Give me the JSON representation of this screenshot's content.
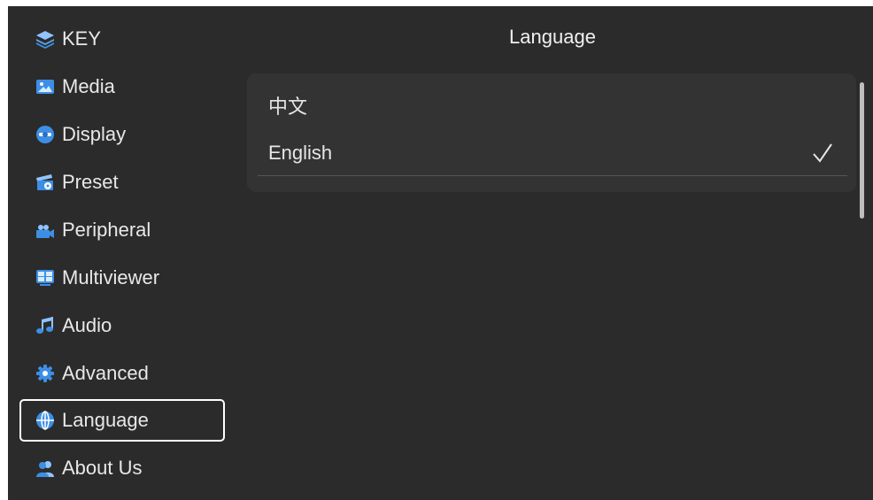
{
  "page": {
    "title": "Language"
  },
  "sidebar": {
    "items": [
      {
        "label": "KEY",
        "icon": "layers-icon"
      },
      {
        "label": "Media",
        "icon": "image-icon"
      },
      {
        "label": "Display",
        "icon": "display-icon"
      },
      {
        "label": "Preset",
        "icon": "preset-icon"
      },
      {
        "label": "Peripheral",
        "icon": "peripheral-icon"
      },
      {
        "label": "Multiviewer",
        "icon": "multiviewer-icon"
      },
      {
        "label": "Audio",
        "icon": "music-note-icon"
      },
      {
        "label": "Advanced",
        "icon": "gear-icon"
      },
      {
        "label": "Language",
        "icon": "globe-icon",
        "selected": true
      },
      {
        "label": "About Us",
        "icon": "users-icon"
      }
    ]
  },
  "language_options": [
    {
      "label": "中文",
      "selected": false
    },
    {
      "label": "English",
      "selected": true
    }
  ],
  "colors": {
    "background": "#2b2b2b",
    "panel": "#333333",
    "text": "#e6e6e6",
    "selected_border": "#ffffff",
    "icon_blue": "#3d8fe6"
  }
}
